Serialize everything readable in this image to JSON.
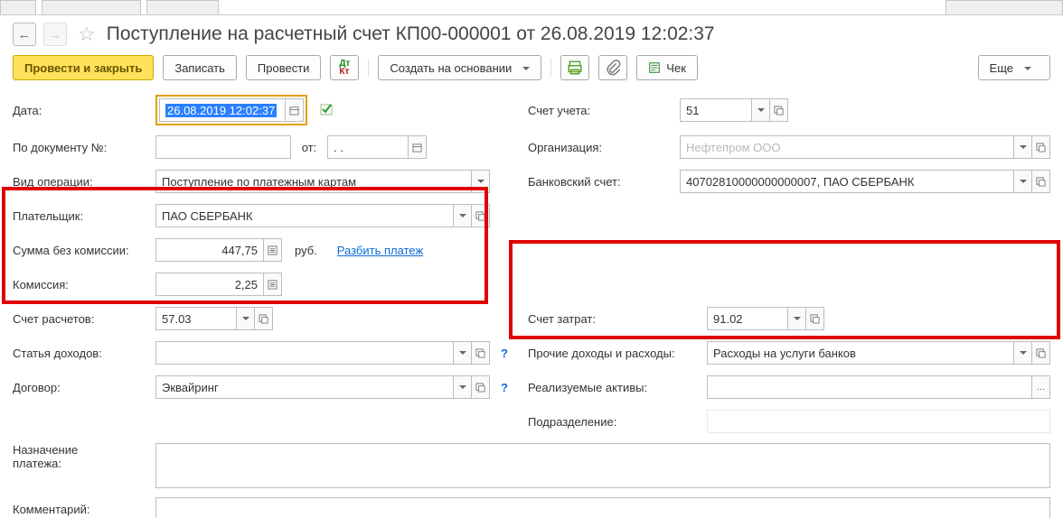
{
  "title": "Поступление на расчетный счет КП00-000001 от 26.08.2019 12:02:37",
  "toolbar": {
    "post_close": "Провести и закрыть",
    "save": "Записать",
    "post": "Провести",
    "create_based": "Создать на основании",
    "cheque": "Чек",
    "more": "Еще"
  },
  "labels": {
    "date": "Дата:",
    "by_doc_no": "По документу №:",
    "from": "от:",
    "op_kind": "Вид операции:",
    "payer": "Плательщик:",
    "sum_no_fee": "Сумма без комиссии:",
    "fee": "Комиссия:",
    "settle_account": "Счет расчетов:",
    "income_item": "Статья доходов:",
    "contract": "Договор:",
    "purpose": "Назначение\nплатежа:",
    "comment": "Комментарий:",
    "gl_account": "Счет учета:",
    "org": "Организация:",
    "bank_account": "Банковский счет:",
    "cost_account": "Счет затрат:",
    "other_income_expense": "Прочие доходы и расходы:",
    "assets_sold": "Реализуемые активы:",
    "department": "Подразделение:",
    "currency": "руб.",
    "split_payment": "Разбить платеж"
  },
  "values": {
    "date": "26.08.2019 12:02:37",
    "doc_no": "",
    "doc_date_mask": ".   .",
    "op_kind": "Поступление по платежным картам",
    "payer": "ПАО СБЕРБАНК",
    "sum_no_fee": "447,75",
    "fee": "2,25",
    "settle_account": "57.03",
    "income_item": "",
    "contract": "Эквайринг",
    "gl_account": "51",
    "org": "Нефтепром ООО",
    "bank_account": "40702810000000000007, ПАО СБЕРБАНК",
    "cost_account": "91.02",
    "other_income_expense": "Расходы на услуги банков",
    "assets_sold": "",
    "department": "",
    "purpose": "",
    "comment": ""
  }
}
